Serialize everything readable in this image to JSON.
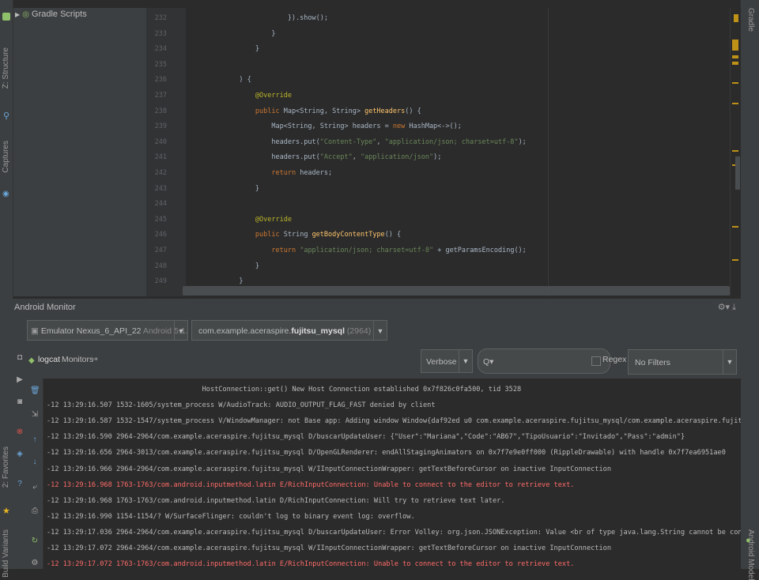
{
  "left_strip": {
    "tabs": [
      "Structure",
      "Z: Structure",
      "Captures",
      "2: Favorites",
      "Build Variants"
    ]
  },
  "right_strip": {
    "tabs": [
      "Gradle",
      "Android Model"
    ]
  },
  "project_panel": {
    "items": [
      {
        "label": "Gradle Scripts",
        "icon": "gradle-icon"
      }
    ]
  },
  "editor": {
    "lines": [
      {
        "num": "232",
        "code": "                        }).show();"
      },
      {
        "num": "233",
        "code": "                    }"
      },
      {
        "num": "234",
        "code": "                }"
      },
      {
        "num": "235",
        "code": ""
      },
      {
        "num": "236",
        "code": "            ) {"
      },
      {
        "num": "237",
        "code": "                @Override"
      },
      {
        "num": "238",
        "code": "                public Map<String, String> getHeaders() {"
      },
      {
        "num": "239",
        "code": "                    Map<String, String> headers = new HashMap<->();"
      },
      {
        "num": "240",
        "code": "                    headers.put(\"Content-Type\", \"application/json; charset=utf-8\");"
      },
      {
        "num": "241",
        "code": "                    headers.put(\"Accept\", \"application/json\");"
      },
      {
        "num": "242",
        "code": "                    return headers;"
      },
      {
        "num": "243",
        "code": "                }"
      },
      {
        "num": "244",
        "code": ""
      },
      {
        "num": "245",
        "code": "                @Override"
      },
      {
        "num": "246",
        "code": "                public String getBodyContentType() {"
      },
      {
        "num": "247",
        "code": "                    return \"application/json; charset=utf-8\" + getParamsEncoding();"
      },
      {
        "num": "248",
        "code": "                }"
      },
      {
        "num": "249",
        "code": "            }"
      }
    ]
  },
  "monitor": {
    "title": "Android Monitor",
    "device": {
      "name": "Emulator Nexus_6_API_22",
      "detail": "Android 5.1.1, API 22"
    },
    "process": {
      "package_prefix": "com.example.aceraspire.",
      "package_app": "fujitsu_mysql",
      "pid": "(2964)"
    },
    "tabs": {
      "logcat": "logcat",
      "monitors": "Monitors"
    },
    "log_level": "Verbose",
    "search_placeholder": "Q▾",
    "regex_label": "Regex",
    "filter": "No Filters",
    "logs": [
      {
        "text": "                                      HostConnection::get() New Host Connection established 0x7f826c0fa500, tid 3528",
        "level": "info"
      },
      {
        "text": "-12 13:29:16.507 1532-1605/system_process W/AudioTrack: AUDIO_OUTPUT_FLAG_FAST denied by client",
        "level": "info"
      },
      {
        "text": "-12 13:29:16.587 1532-1547/system_process V/WindowManager: not Base app: Adding window Window{daf92ed u0 com.example.aceraspire.fujitsu_mysql/com.example.aceraspire.fujitsu_mysql.buscarUpdat",
        "level": "info"
      },
      {
        "text": "-12 13:29:16.590 2964-2964/com.example.aceraspire.fujitsu_mysql D/buscarUpdateUser: {\"User\":\"Mariana\",\"Code\":\"AB67\",\"TipoUsuario\":\"Invitado\",\"Pass\":\"admin\"}",
        "level": "info"
      },
      {
        "text": "-12 13:29:16.656 2964-3013/com.example.aceraspire.fujitsu_mysql D/OpenGLRenderer: endAllStagingAnimators on 0x7f7e9e0ff000 (RippleDrawable) with handle 0x7f7ea6951ae0",
        "level": "info"
      },
      {
        "text": "-12 13:29:16.966 2964-2964/com.example.aceraspire.fujitsu_mysql W/IInputConnectionWrapper: getTextBeforeCursor on inactive InputConnection",
        "level": "info"
      },
      {
        "text": "-12 13:29:16.968 1763-1763/com.android.inputmethod.latin E/RichInputConnection: Unable to connect to the editor to retrieve text.",
        "level": "error"
      },
      {
        "text": "-12 13:29:16.968 1763-1763/com.android.inputmethod.latin D/RichInputConnection: Will try to retrieve text later.",
        "level": "info"
      },
      {
        "text": "-12 13:29:16.990 1154-1154/? W/SurfaceFlinger: couldn't log to binary event log: overflow.",
        "level": "info"
      },
      {
        "text": "-12 13:29:17.036 2964-2964/com.example.aceraspire.fujitsu_mysql D/buscarUpdateUser: Error Volley: org.json.JSONException: Value <br of type java.lang.String cannot be converted to JSONObject",
        "level": "info"
      },
      {
        "text": "-12 13:29:17.072 2964-2964/com.example.aceraspire.fujitsu_mysql W/IInputConnectionWrapper: getTextBeforeCursor on inactive InputConnection",
        "level": "info"
      },
      {
        "text": "-12 13:29:17.072 1763-1763/com.android.inputmethod.latin E/RichInputConnection: Unable to connect to the editor to retrieve text.",
        "level": "error"
      }
    ]
  },
  "colors": {
    "error": "#ff6b68",
    "keyword": "#cc7832",
    "string": "#6a8759",
    "annotation": "#bbb529",
    "method": "#ffc66d",
    "marker": "#be9117"
  }
}
